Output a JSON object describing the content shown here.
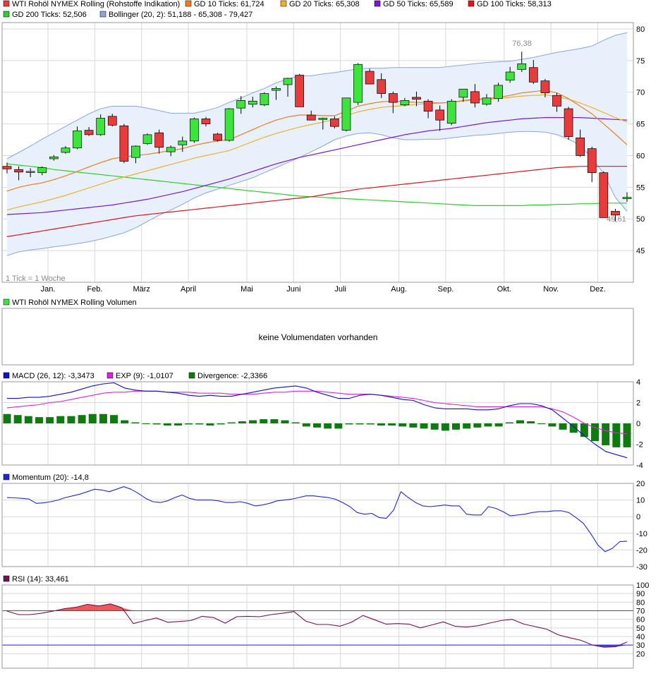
{
  "colors": {
    "gd10": "#f07c1e",
    "gd20": "#f0b028",
    "gd50": "#7a16d6",
    "gd100": "#e0141c",
    "gd200": "#28d228",
    "bollinger_line": "#8aa6d8",
    "bollinger_fill": "#e8f0fc",
    "candle_up": "#3ce43c",
    "candle_down": "#e83c3c",
    "macd": "#1010d0",
    "exp": "#e020e0",
    "divergence": "#0f7a0f",
    "momentum": "#1c28e0",
    "rsi": "#7a0e52",
    "rsi_70": "#e0141c",
    "rsi_30": "#1c28e0",
    "grid": "#d8d8d8"
  },
  "main": {
    "legend": [
      {
        "label": "WTI Rohöl NYMEX Rolling (Rohstoffe Indikation)",
        "color": "#e83c3c"
      },
      {
        "label": "GD 10 Ticks: 61,724",
        "color": "#f07c1e"
      },
      {
        "label": "GD 20 Ticks: 65,308",
        "color": "#f0b028"
      },
      {
        "label": "GD 50 Ticks: 65,589",
        "color": "#7a16d6"
      },
      {
        "label": "GD 100 Ticks: 58,313",
        "color": "#e0141c"
      },
      {
        "label": "GD 200 Ticks: 52,506",
        "color": "#28d228"
      },
      {
        "label": "Bollinger (20, 2): 51,188 - 65,308 - 79,427",
        "color": "#8aa6d8"
      }
    ],
    "tick_note": "1 Tick = 1 Woche",
    "high_label": "76,38",
    "low_label": "49,61"
  },
  "volume": {
    "legend": "WTI Rohöl NYMEX Rolling Volumen",
    "legend_color": "#3ce43c",
    "message": "keine Volumendaten vorhanden"
  },
  "macd_panel": {
    "legend": [
      {
        "label": "MACD (26, 12): -3,3473",
        "color": "#1010d0"
      },
      {
        "label": "EXP (9): -1,0107",
        "color": "#e020e0"
      },
      {
        "label": "Divergence: -2,3366",
        "color": "#0f7a0f"
      }
    ]
  },
  "momentum_panel": {
    "legend": "Momentum (20): -14,8",
    "legend_color": "#1c28e0"
  },
  "rsi_panel": {
    "legend": "RSI (14): 33,461",
    "legend_color": "#7a0e52"
  },
  "chart_data": [
    {
      "type": "candlestick",
      "title": "WTI Rohöl NYMEX Rolling (Rohstoffe Indikation)",
      "x_labels": [
        "Jan.",
        "Feb.",
        "März",
        "April",
        "Mai",
        "Juni",
        "Juli",
        "Aug.",
        "Sep.",
        "Okt.",
        "Nov.",
        "Dez."
      ],
      "x_label_weeks": [
        5,
        9,
        13,
        17,
        22,
        26,
        30,
        35,
        39,
        44,
        48,
        52
      ],
      "ylim": [
        40,
        81
      ],
      "y_ticks": [
        45,
        50,
        55,
        60,
        65,
        70,
        75,
        80
      ],
      "candles": [
        {
          "o": 58.3,
          "h": 58.9,
          "l": 57.2,
          "c": 57.9
        },
        {
          "o": 57.8,
          "h": 58.3,
          "l": 56.1,
          "c": 57.4
        },
        {
          "o": 57.4,
          "h": 58.0,
          "l": 56.6,
          "c": 57.5
        },
        {
          "o": 57.3,
          "h": 58.3,
          "l": 56.9,
          "c": 58.1
        },
        {
          "o": 59.5,
          "h": 60.1,
          "l": 59.2,
          "c": 59.8
        },
        {
          "o": 60.5,
          "h": 61.5,
          "l": 60.3,
          "c": 61.2
        },
        {
          "o": 61.2,
          "h": 64.6,
          "l": 61.0,
          "c": 63.9
        },
        {
          "o": 64.0,
          "h": 64.5,
          "l": 63.1,
          "c": 63.3
        },
        {
          "o": 63.3,
          "h": 66.5,
          "l": 63.1,
          "c": 65.9
        },
        {
          "o": 66.2,
          "h": 66.6,
          "l": 64.6,
          "c": 64.8
        },
        {
          "o": 64.7,
          "h": 65.0,
          "l": 58.8,
          "c": 59.1
        },
        {
          "o": 59.7,
          "h": 61.6,
          "l": 58.8,
          "c": 61.5
        },
        {
          "o": 61.9,
          "h": 63.5,
          "l": 61.7,
          "c": 63.3
        },
        {
          "o": 63.6,
          "h": 64.1,
          "l": 60.3,
          "c": 61.3
        },
        {
          "o": 60.6,
          "h": 61.6,
          "l": 59.9,
          "c": 61.3
        },
        {
          "o": 61.7,
          "h": 63.0,
          "l": 60.6,
          "c": 62.3
        },
        {
          "o": 62.3,
          "h": 66.0,
          "l": 62.0,
          "c": 65.8
        },
        {
          "o": 65.8,
          "h": 66.1,
          "l": 64.6,
          "c": 65.0
        },
        {
          "o": 63.4,
          "h": 63.6,
          "l": 62.2,
          "c": 62.4
        },
        {
          "o": 62.4,
          "h": 67.5,
          "l": 62.2,
          "c": 67.4
        },
        {
          "o": 67.5,
          "h": 69.4,
          "l": 66.6,
          "c": 68.7
        },
        {
          "o": 68.1,
          "h": 69.3,
          "l": 67.6,
          "c": 68.6
        },
        {
          "o": 68.0,
          "h": 70.0,
          "l": 67.8,
          "c": 69.8
        },
        {
          "o": 70.3,
          "h": 70.9,
          "l": 68.8,
          "c": 70.6
        },
        {
          "o": 71.2,
          "h": 72.3,
          "l": 69.3,
          "c": 72.2
        },
        {
          "o": 72.7,
          "h": 72.9,
          "l": 67.7,
          "c": 67.7
        },
        {
          "o": 66.4,
          "h": 67.1,
          "l": 65.6,
          "c": 65.6
        },
        {
          "o": 65.7,
          "h": 66.0,
          "l": 64.1,
          "c": 65.9
        },
        {
          "o": 65.8,
          "h": 66.2,
          "l": 64.3,
          "c": 64.6
        },
        {
          "o": 64.0,
          "h": 69.1,
          "l": 63.8,
          "c": 69.1
        },
        {
          "o": 68.4,
          "h": 74.6,
          "l": 68.0,
          "c": 74.4
        },
        {
          "o": 73.3,
          "h": 73.7,
          "l": 71.3,
          "c": 71.3
        },
        {
          "o": 72.0,
          "h": 73.0,
          "l": 69.1,
          "c": 69.8
        },
        {
          "o": 69.8,
          "h": 70.1,
          "l": 66.7,
          "c": 68.4
        },
        {
          "o": 68.0,
          "h": 69.1,
          "l": 67.8,
          "c": 68.7
        },
        {
          "o": 69.2,
          "h": 70.1,
          "l": 67.8,
          "c": 68.9
        },
        {
          "o": 68.6,
          "h": 68.9,
          "l": 65.9,
          "c": 67.0
        },
        {
          "o": 67.2,
          "h": 67.9,
          "l": 63.9,
          "c": 65.6
        },
        {
          "o": 65.1,
          "h": 68.9,
          "l": 64.8,
          "c": 68.6
        },
        {
          "o": 69.2,
          "h": 70.5,
          "l": 68.5,
          "c": 70.5
        },
        {
          "o": 70.1,
          "h": 71.3,
          "l": 67.6,
          "c": 68.3
        },
        {
          "o": 68.1,
          "h": 69.7,
          "l": 67.9,
          "c": 69.1
        },
        {
          "o": 69.0,
          "h": 71.5,
          "l": 68.5,
          "c": 71.1
        },
        {
          "o": 71.9,
          "h": 74.0,
          "l": 71.5,
          "c": 73.2
        },
        {
          "o": 73.6,
          "h": 76.4,
          "l": 73.2,
          "c": 74.5
        },
        {
          "o": 73.9,
          "h": 75.1,
          "l": 71.3,
          "c": 71.6
        },
        {
          "o": 71.8,
          "h": 72.1,
          "l": 69.2,
          "c": 69.9
        },
        {
          "o": 69.5,
          "h": 69.9,
          "l": 66.9,
          "c": 67.8
        },
        {
          "o": 67.4,
          "h": 67.7,
          "l": 62.5,
          "c": 63.0
        },
        {
          "o": 62.8,
          "h": 64.1,
          "l": 59.8,
          "c": 60.0
        },
        {
          "o": 61.1,
          "h": 61.4,
          "l": 55.8,
          "c": 57.3
        },
        {
          "o": 57.3,
          "h": 57.5,
          "l": 50.2,
          "c": 50.2
        },
        {
          "o": 51.2,
          "h": 51.6,
          "l": 49.6,
          "c": 50.6
        },
        {
          "o": 53.2,
          "h": 54.2,
          "l": 52.7,
          "c": 53.4
        }
      ],
      "gd10": [
        54.4,
        55.0,
        55.4,
        55.7,
        56.2,
        56.8,
        57.5,
        58.2,
        58.9,
        59.5,
        59.8,
        60.0,
        60.2,
        60.5,
        60.8,
        61.1,
        61.6,
        62.0,
        62.3,
        62.5,
        63.3,
        64.1,
        64.9,
        65.6,
        66.1,
        66.4,
        66.4,
        66.3,
        66.3,
        67.0,
        67.8,
        68.2,
        68.5,
        68.6,
        68.5,
        68.4,
        68.4,
        68.3,
        68.4,
        68.7,
        68.9,
        69.0,
        69.2,
        69.5,
        69.9,
        70.1,
        70.3,
        69.9,
        69.0,
        67.8,
        66.6,
        65.0,
        63.4,
        61.7
      ],
      "gd20": [
        51.4,
        51.9,
        52.3,
        52.7,
        53.2,
        53.7,
        54.3,
        54.9,
        55.5,
        56.1,
        56.6,
        57.1,
        57.6,
        58.1,
        58.6,
        59.1,
        59.6,
        60.0,
        60.4,
        60.8,
        61.5,
        62.2,
        62.9,
        63.5,
        64.0,
        64.5,
        64.9,
        65.3,
        65.7,
        66.3,
        66.9,
        67.3,
        67.6,
        67.8,
        67.9,
        68.1,
        68.2,
        68.3,
        68.4,
        68.6,
        68.8,
        68.9,
        69.0,
        69.2,
        69.4,
        69.5,
        69.6,
        69.3,
        68.9,
        68.3,
        67.6,
        66.8,
        66.0,
        65.3
      ],
      "gd50": [
        50.7,
        50.8,
        50.9,
        51.0,
        51.2,
        51.4,
        51.6,
        51.8,
        52.0,
        52.2,
        52.5,
        52.8,
        53.1,
        53.5,
        53.9,
        54.3,
        54.8,
        55.3,
        55.8,
        56.3,
        56.9,
        57.5,
        58.1,
        58.7,
        59.2,
        59.7,
        60.1,
        60.5,
        60.9,
        61.3,
        61.7,
        62.1,
        62.5,
        62.9,
        63.3,
        63.6,
        63.9,
        64.1,
        64.3,
        64.6,
        64.9,
        65.2,
        65.4,
        65.6,
        65.8,
        65.9,
        66.0,
        66.0,
        66.0,
        66.0,
        65.9,
        65.8,
        65.7,
        65.6
      ],
      "gd100": [
        47.2,
        47.5,
        47.8,
        48.1,
        48.4,
        48.7,
        49.0,
        49.3,
        49.6,
        49.9,
        50.2,
        50.5,
        50.7,
        50.9,
        51.1,
        51.3,
        51.5,
        51.7,
        51.9,
        52.1,
        52.3,
        52.5,
        52.7,
        52.9,
        53.1,
        53.3,
        53.5,
        53.8,
        54.1,
        54.4,
        54.7,
        54.9,
        55.1,
        55.3,
        55.5,
        55.7,
        55.9,
        56.1,
        56.3,
        56.5,
        56.7,
        56.9,
        57.1,
        57.3,
        57.5,
        57.7,
        57.9,
        58.1,
        58.2,
        58.3,
        58.3,
        58.3,
        58.3,
        58.3
      ],
      "gd200": [
        58.7,
        58.5,
        58.3,
        58.1,
        57.8,
        57.6,
        57.4,
        57.2,
        57.0,
        56.8,
        56.6,
        56.4,
        56.2,
        56.0,
        55.8,
        55.6,
        55.4,
        55.2,
        55.0,
        54.8,
        54.6,
        54.4,
        54.2,
        54.0,
        53.8,
        53.6,
        53.5,
        53.4,
        53.3,
        53.2,
        53.1,
        53.0,
        52.9,
        52.8,
        52.7,
        52.6,
        52.5,
        52.4,
        52.3,
        52.2,
        52.1,
        52.1,
        52.1,
        52.1,
        52.1,
        52.2,
        52.2,
        52.3,
        52.3,
        52.4,
        52.4,
        52.5,
        52.5,
        52.5
      ],
      "bollinger_upper": [
        59.5,
        60.5,
        61.5,
        62.6,
        63.6,
        64.6,
        65.6,
        66.6,
        67.4,
        67.8,
        67.8,
        67.8,
        67.5,
        67.1,
        66.7,
        66.7,
        66.7,
        67.1,
        67.6,
        68.4,
        69.1,
        69.9,
        70.6,
        71.5,
        72.1,
        72.6,
        72.6,
        72.9,
        73.1,
        73.4,
        73.7,
        73.8,
        73.8,
        73.9,
        73.9,
        73.9,
        73.9,
        73.9,
        74.1,
        74.3,
        74.5,
        74.7,
        74.8,
        74.9,
        75.2,
        75.5,
        75.9,
        76.3,
        76.6,
        76.9,
        77.3,
        78.2,
        79.0,
        79.4
      ],
      "bollinger_lower": [
        44.2,
        44.8,
        45.1,
        45.3,
        45.6,
        45.8,
        46.1,
        46.4,
        46.8,
        47.3,
        47.8,
        48.6,
        49.6,
        50.6,
        51.4,
        52.3,
        53.3,
        54.1,
        54.7,
        55.3,
        55.9,
        56.5,
        57.3,
        58.1,
        58.9,
        59.7,
        60.6,
        61.5,
        62.5,
        63.1,
        63.5,
        63.6,
        63.3,
        62.8,
        62.5,
        62.5,
        62.6,
        62.6,
        62.8,
        63.0,
        63.2,
        63.3,
        63.5,
        63.7,
        63.8,
        63.8,
        63.7,
        63.3,
        62.6,
        61.6,
        59.6,
        57.2,
        53.4,
        51.2
      ]
    },
    {
      "type": "macd",
      "ylim": [
        -4,
        4
      ],
      "y_ticks": [
        -4,
        -2,
        0,
        2,
        4
      ],
      "macd": [
        2.4,
        2.4,
        2.5,
        2.5,
        2.6,
        2.8,
        3.0,
        3.3,
        3.6,
        3.8,
        3.9,
        3.4,
        3.2,
        3.1,
        3.1,
        3.0,
        2.9,
        2.7,
        2.6,
        2.7,
        2.6,
        2.6,
        2.8,
        3.0,
        3.2,
        3.4,
        3.5,
        3.6,
        3.4,
        3.0,
        2.7,
        2.4,
        2.4,
        2.7,
        2.8,
        2.7,
        2.5,
        2.3,
        2.2,
        1.8,
        1.5,
        1.4,
        1.4,
        1.4,
        1.3,
        1.3,
        1.4,
        1.7,
        1.9,
        1.9,
        1.7,
        1.3,
        0.5,
        -0.3,
        -1.2,
        -2.0,
        -2.7,
        -3.0,
        -3.3
      ],
      "exp": [
        1.5,
        1.6,
        1.7,
        1.8,
        2.0,
        2.1,
        2.3,
        2.5,
        2.7,
        2.9,
        3.0,
        3.0,
        3.1,
        3.1,
        3.1,
        3.0,
        3.0,
        3.0,
        2.9,
        2.9,
        2.9,
        2.8,
        2.8,
        2.8,
        2.9,
        3.0,
        3.0,
        3.1,
        3.1,
        3.1,
        3.0,
        2.9,
        2.8,
        2.8,
        2.8,
        2.7,
        2.6,
        2.5,
        2.4,
        2.2,
        2.0,
        1.9,
        1.8,
        1.7,
        1.6,
        1.6,
        1.6,
        1.6,
        1.6,
        1.6,
        1.6,
        1.4,
        1.1,
        0.6,
        0.0,
        -0.4,
        -0.7,
        -0.9,
        -1.0
      ],
      "divergence": [
        0.9,
        0.8,
        0.7,
        0.6,
        0.6,
        0.7,
        0.7,
        0.8,
        0.9,
        0.9,
        0.8,
        0.3,
        0.1,
        0.0,
        -0.1,
        -0.2,
        -0.2,
        -0.1,
        -0.1,
        -0.2,
        -0.1,
        0.1,
        0.2,
        0.3,
        0.4,
        0.4,
        0.3,
        0.1,
        -0.3,
        -0.4,
        -0.5,
        -0.5,
        -0.1,
        -0.1,
        -0.1,
        -0.2,
        -0.2,
        -0.3,
        -0.4,
        -0.5,
        -0.6,
        -0.7,
        -0.6,
        -0.5,
        -0.4,
        -0.3,
        -0.3,
        0.1,
        0.3,
        0.2,
        0.0,
        -0.3,
        -0.6,
        -0.9,
        -1.3,
        -1.7,
        -2.1,
        -2.3,
        -2.3
      ]
    },
    {
      "type": "line",
      "title": "Momentum (20)",
      "ylim": [
        -30,
        20
      ],
      "y_ticks": [
        -30,
        -20,
        -10,
        0,
        10,
        20
      ],
      "values": [
        11.5,
        11.3,
        11.0,
        10.6,
        8.0,
        8.3,
        9.0,
        10.0,
        11.5,
        12.5,
        13.5,
        15.0,
        16.5,
        16.0,
        15.0,
        16.5,
        18.0,
        16.5,
        14.0,
        11.0,
        9.0,
        8.5,
        9.5,
        11.5,
        13.0,
        11.0,
        10.0,
        10.0,
        10.0,
        9.5,
        8.5,
        8.5,
        9.0,
        8.0,
        6.5,
        7.0,
        8.0,
        9.5,
        10.0,
        10.5,
        11.5,
        12.5,
        12.5,
        12.0,
        11.5,
        10.5,
        8.5,
        6.0,
        2.5,
        1.5,
        2.0,
        -0.5,
        -1.0,
        4.0,
        15.0,
        11.5,
        8.5,
        6.5,
        6.0,
        6.5,
        7.0,
        6.5,
        6.5,
        1.5,
        1.0,
        1.0,
        6.0,
        5.0,
        3.0,
        0.5,
        1.0,
        1.5,
        2.5,
        3.0,
        3.0,
        3.5,
        3.5,
        2.5,
        -0.5,
        -4.0,
        -10.0,
        -17.0,
        -21.0,
        -19.0,
        -15.0,
        -14.8
      ],
      "sample_weeks_note": ""
    },
    {
      "type": "line",
      "title": "RSI (14)",
      "ylim": [
        0,
        100
      ],
      "y_ticks": [
        20,
        30,
        40,
        50,
        60,
        70,
        80,
        90,
        100
      ],
      "reference_lines": [
        70,
        30
      ],
      "values": [
        69.5,
        65.5,
        65.5,
        67.0,
        69.5,
        72.5,
        74.0,
        77.5,
        75.5,
        78.0,
        73.5,
        55.0,
        58.5,
        61.5,
        56.5,
        57.5,
        58.5,
        63.5,
        62.0,
        55.5,
        63.0,
        63.5,
        63.0,
        65.5,
        67.0,
        69.0,
        58.0,
        54.0,
        54.0,
        52.0,
        56.5,
        64.5,
        59.5,
        54.5,
        55.0,
        54.5,
        50.0,
        53.5,
        57.0,
        52.0,
        51.0,
        52.5,
        55.5,
        58.5,
        60.0,
        54.5,
        51.5,
        48.5,
        42.0,
        38.5,
        35.5,
        30.0,
        27.5,
        28.0,
        33.5
      ]
    }
  ]
}
